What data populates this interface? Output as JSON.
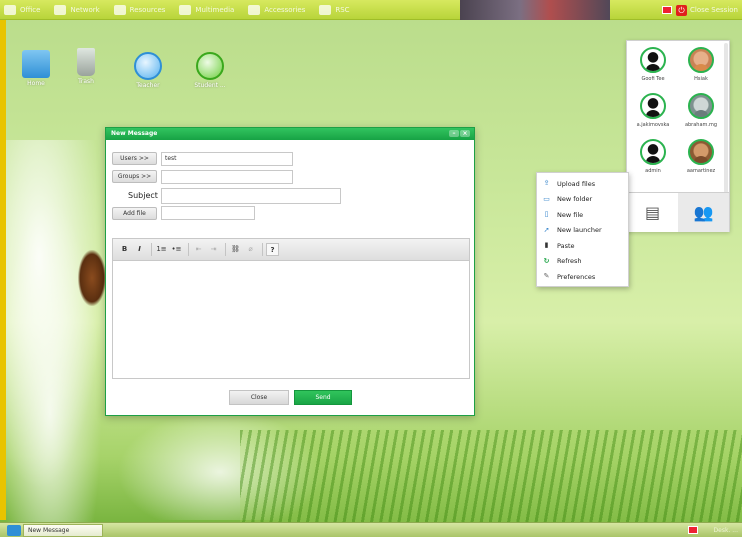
{
  "topbar": {
    "menus": [
      {
        "label": "Office",
        "icon": "office-icon"
      },
      {
        "label": "Network",
        "icon": "network-icon"
      },
      {
        "label": "Resources",
        "icon": "resources-icon"
      },
      {
        "label": "Multimedia",
        "icon": "multimedia-icon"
      },
      {
        "label": "Accessories",
        "icon": "accessories-icon"
      },
      {
        "label": "RSC",
        "icon": "rsc-icon"
      }
    ],
    "close_session": "Close Session"
  },
  "desktop_icons": [
    {
      "label": "Home",
      "icon": "home-icon"
    },
    {
      "label": "Trash",
      "icon": "trash-icon"
    },
    {
      "label": "Teacher",
      "icon": "chat-bubble-icon"
    },
    {
      "label": "Student ...",
      "icon": "chat-bubble-icon"
    }
  ],
  "message_window": {
    "title": "New Message",
    "users_button": "Users >>",
    "users_value": "test",
    "groups_button": "Groups >>",
    "groups_value": "",
    "subject_label": "Subject",
    "subject_value": "",
    "add_file_button": "Add file",
    "add_file_value": "",
    "toolbar": {
      "bold": "B",
      "italic": "I",
      "ordered_list": "1≡",
      "unordered_list": "•≡",
      "outdent": "⇤",
      "indent": "⇥",
      "link": "⛓",
      "unlink": "⌀",
      "help": "?"
    },
    "close_button": "Close",
    "send_button": "Send"
  },
  "users_panel": {
    "users": [
      {
        "name": "Goofi Tee",
        "avatar": "default"
      },
      {
        "name": "Hsiak",
        "avatar": "photo1"
      },
      {
        "name": "a.jakimovska",
        "avatar": "default"
      },
      {
        "name": "abraham.mg",
        "avatar": "photo2"
      },
      {
        "name": "admin",
        "avatar": "default"
      },
      {
        "name": "aamartinez",
        "avatar": "photo3"
      }
    ],
    "tabs": [
      {
        "name": "contact-card-icon",
        "glyph": "▤"
      },
      {
        "name": "group-icon",
        "glyph": "👥"
      }
    ]
  },
  "context_menu": {
    "items": [
      {
        "label": "Upload files",
        "icon": "upload-icon",
        "glyph": "⇪"
      },
      {
        "label": "New folder",
        "icon": "folder-icon",
        "glyph": "▭"
      },
      {
        "label": "New file",
        "icon": "file-icon",
        "glyph": "▯"
      },
      {
        "label": "New launcher",
        "icon": "launcher-icon",
        "glyph": "➚"
      },
      {
        "label": "Paste",
        "icon": "paste-icon",
        "glyph": "▮"
      },
      {
        "label": "Refresh",
        "icon": "refresh-icon",
        "glyph": "↻"
      },
      {
        "label": "Preferences",
        "icon": "wrench-icon",
        "glyph": "✎"
      }
    ]
  },
  "taskbar": {
    "task_item": "New Message",
    "right_text": "Desk. ..."
  },
  "colors": {
    "accent_green": "#1ea446",
    "topbar": "#c2da44",
    "desktop": "#c5e496"
  }
}
